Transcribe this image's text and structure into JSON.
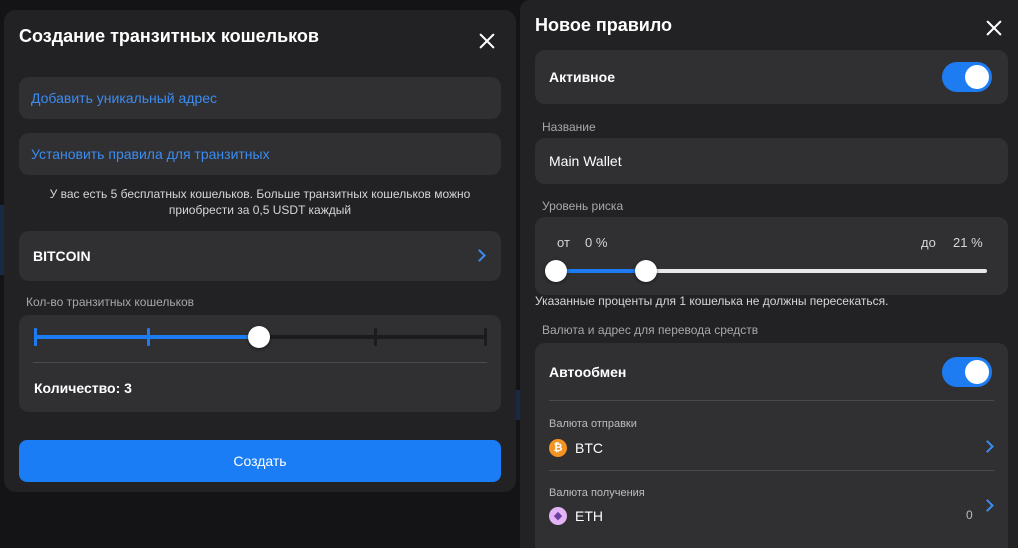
{
  "left_modal": {
    "title": "Создание транзитных кошельков",
    "add_unique_address": "Добавить уникальный адрес",
    "set_transit_rules": "Установить правила для транзитных",
    "info": "У вас есть 5 бесплатных кошельков. Больше транзитных кошельков можно приобрести за 0,5 USDT каждый",
    "network": "BITCOIN",
    "count_label": "Кол-во транзитных кошельков",
    "slider": {
      "min": 1,
      "max": 5,
      "value": 3
    },
    "quantity_text": "Количество: 3",
    "create_button": "Создать"
  },
  "right_modal": {
    "title": "Новое правило",
    "active_label": "Активное",
    "active_on": true,
    "name_label": "Название",
    "name_value": "Main Wallet",
    "risk_label": "Уровень риска",
    "risk_from_label": "от",
    "risk_from_value": "0 %",
    "risk_to_label": "до",
    "risk_to_value": "21 %",
    "risk_range": {
      "from": 0,
      "to": 21
    },
    "risk_note": "Указанные проценты для 1 кошелька не должны пересекаться.",
    "currency_section_label": "Валюта и адрес для перевода средств",
    "autoexchange_label": "Автообмен",
    "autoexchange_on": true,
    "send_currency_label": "Валюта отправки",
    "send_currency": "BTC",
    "receive_currency_label": "Валюта получения",
    "receive_currency": "ETH",
    "receive_amount": "0"
  },
  "colors": {
    "accent": "#1e7cf2",
    "link": "#3b8cf0",
    "panel": "#222224",
    "card": "#303033",
    "btc": "#f39321",
    "eth": "#e4b3f5"
  },
  "icons": {
    "close": "close-icon",
    "chevron": "chevron-right-icon",
    "btc": "bitcoin-icon",
    "eth": "ethereum-icon"
  }
}
